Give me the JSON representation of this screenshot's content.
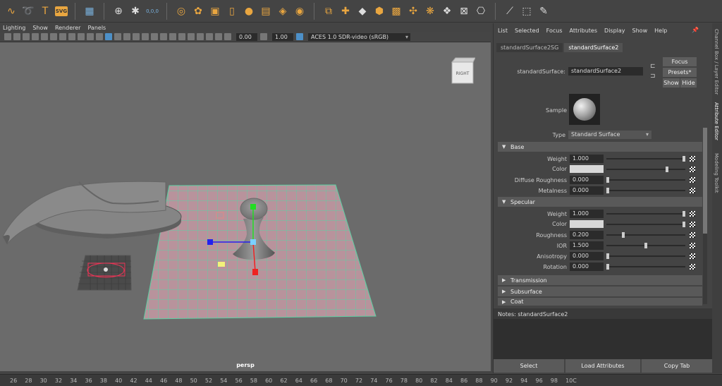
{
  "shelf": {
    "icons": [
      "curve-icon",
      "spiral-icon",
      "text-tool-icon",
      "svg-icon",
      "grid-icon",
      "snap-icon",
      "pivot-icon",
      "coords-icon",
      "lasso-icon",
      "sculpt-icon",
      "cube-icon",
      "cylinder-icon",
      "sphere-icon",
      "plane-icon",
      "torus-icon",
      "cone-icon",
      "transform-icon",
      "multi-cut-icon",
      "extrude-icon",
      "bevel-icon",
      "bridge-icon",
      "merge-icon",
      "uv-icon",
      "camera-icon",
      "crease-icon",
      "mirror-icon",
      "bound-box-icon",
      "pencil-icon"
    ],
    "svg_label": "SVG",
    "coords_label": "0,0,0"
  },
  "viewport_menu": [
    "Lighting",
    "Show",
    "Renderer",
    "Panels"
  ],
  "viewport_tools": {
    "exposure": "0.00",
    "gamma": "1.00",
    "colorspace": "ACES 1.0 SDR-video (sRGB)"
  },
  "viewport": {
    "camera": "persp",
    "viewcube_label": "RIGHT"
  },
  "attribute_editor": {
    "menu": [
      "List",
      "Selected",
      "Focus",
      "Attributes",
      "Display",
      "Show",
      "Help"
    ],
    "tabs": [
      "standardSurface2SG",
      "standardSurface2"
    ],
    "node_label": "standardSurface:",
    "node_name": "standardSurface2",
    "buttons": {
      "focus": "Focus",
      "presets": "Presets*",
      "show": "Show",
      "hide": "Hide"
    },
    "sample_label": "Sample",
    "type_label": "Type",
    "type_value": "Standard Surface",
    "sections": {
      "base": "Base",
      "specular": "Specular",
      "transmission": "Transmission",
      "subsurface": "Subsurface",
      "coat": "Coat"
    },
    "base_attrs": [
      {
        "label": "Weight",
        "value": "1.000",
        "level": 1.0
      },
      {
        "label": "Color",
        "value": "",
        "level": 0.78
      },
      {
        "label": "Diffuse Roughness",
        "value": "0.000",
        "level": 0.0
      },
      {
        "label": "Metalness",
        "value": "0.000",
        "level": 0.0
      }
    ],
    "specular_attrs": [
      {
        "label": "Weight",
        "value": "1.000",
        "level": 1.0
      },
      {
        "label": "Color",
        "value": "",
        "level": 1.0
      },
      {
        "label": "Roughness",
        "value": "0.200",
        "level": 0.2
      },
      {
        "label": "IOR",
        "value": "1.500",
        "level": 0.5
      },
      {
        "label": "Anisotropy",
        "value": "0.000",
        "level": 0.0
      },
      {
        "label": "Rotation",
        "value": "0.000",
        "level": 0.0
      }
    ],
    "notes_label": "Notes:  standardSurface2",
    "bottom_buttons": {
      "select": "Select",
      "load": "Load Attributes",
      "copy": "Copy Tab"
    }
  },
  "sidebar_tabs": [
    "Channel Box / Layer Editor",
    "Attribute Editor",
    "Modeling Toolkit"
  ],
  "timeline": [
    "26",
    "28",
    "30",
    "32",
    "34",
    "36",
    "38",
    "40",
    "42",
    "44",
    "46",
    "48",
    "50",
    "52",
    "54",
    "56",
    "58",
    "60",
    "62",
    "64",
    "66",
    "68",
    "70",
    "72",
    "74",
    "76",
    "78",
    "80",
    "82",
    "84",
    "86",
    "88",
    "90",
    "92",
    "94",
    "96",
    "98",
    "10C"
  ]
}
